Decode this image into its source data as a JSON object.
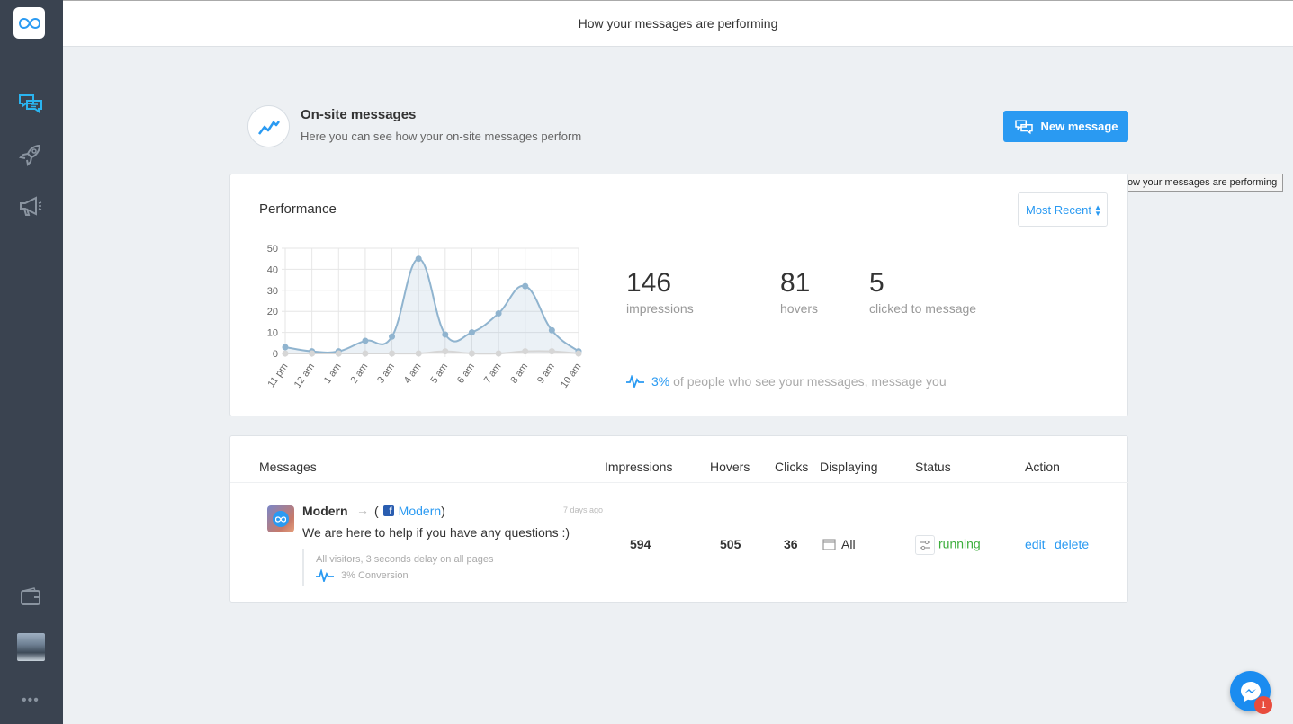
{
  "topbar": {
    "title": "How your messages are performing"
  },
  "tooltip": {
    "text": "How your messages are performing"
  },
  "header": {
    "title": "On-site messages",
    "subtitle": "Here you can see how your on-site messages perform",
    "new_button": "New message"
  },
  "performance": {
    "title": "Performance",
    "filter": "Most Recent",
    "stats": [
      {
        "value": "146",
        "label": "impressions"
      },
      {
        "value": "81",
        "label": "hovers"
      },
      {
        "value": "5",
        "label": "clicked to message"
      }
    ],
    "conversion_pct": "3%",
    "conversion_text": "of people who see your messages, message you"
  },
  "chart_data": {
    "type": "line",
    "categories": [
      "11 pm",
      "12 am",
      "1 am",
      "2 am",
      "3 am",
      "4 am",
      "5 am",
      "6 am",
      "7 am",
      "8 am",
      "9 am",
      "10 am"
    ],
    "series": [
      {
        "values": [
          3,
          1,
          1,
          6,
          8,
          45,
          9,
          10,
          19,
          32,
          11,
          1
        ],
        "color": "#90b4cf"
      },
      {
        "values": [
          0,
          0,
          0,
          0,
          0,
          0,
          1,
          0,
          0,
          1,
          1,
          0
        ],
        "color": "#d6d6d6"
      }
    ],
    "ylim": [
      0,
      50
    ],
    "yticks": [
      0,
      10,
      20,
      30,
      40,
      50
    ],
    "grid": true
  },
  "messages": {
    "headers": {
      "messages": "Messages",
      "impressions": "Impressions",
      "hovers": "Hovers",
      "clicks": "Clicks",
      "displaying": "Displaying",
      "status": "Status",
      "action": "Action"
    },
    "rows": [
      {
        "name": "Modern",
        "paren_open": "(",
        "link": "Modern",
        "paren_close": ")",
        "age": "7 days ago",
        "text": "We are here to help if you have any questions :)",
        "targeting": "All visitors, 3 seconds delay on all pages",
        "conversion": "3% Conversion",
        "impressions": "594",
        "hovers": "505",
        "clicks": "36",
        "displaying": "All",
        "status": "running",
        "edit": "edit",
        "delete": "delete"
      }
    ]
  },
  "messenger": {
    "badge": "1"
  },
  "colors": {
    "accent": "#2a9af2",
    "sidebar": "#3a4350",
    "running": "#3cae3c"
  }
}
